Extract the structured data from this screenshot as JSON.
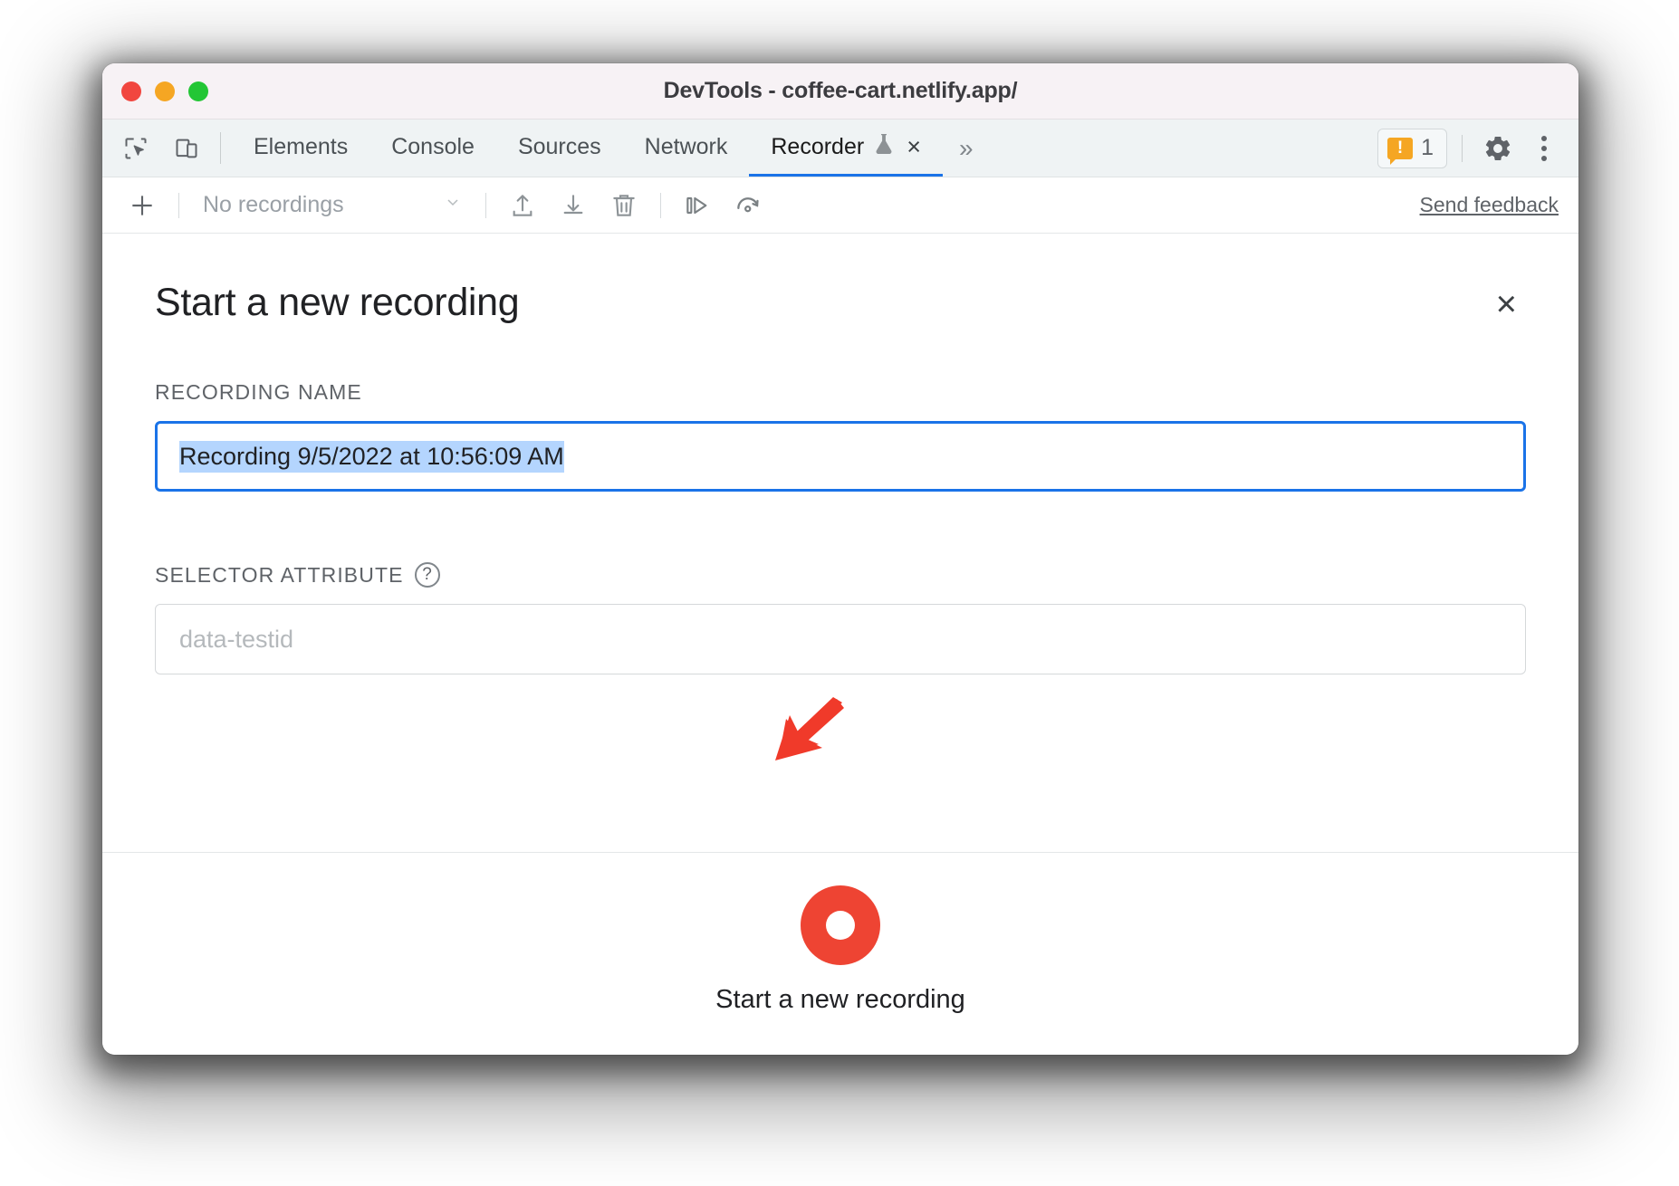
{
  "window": {
    "title": "DevTools - coffee-cart.netlify.app/",
    "traffic_lights": [
      "close",
      "minimize",
      "maximize"
    ],
    "colors": {
      "titlebar_bg": "#f7f2f5",
      "close": "#f1463f",
      "minimize": "#f5a623",
      "maximize": "#23c635",
      "accent": "#1a73e8",
      "record_red": "#ee4433",
      "selection_blue": "#b4d5fe",
      "annotation_red": "#f03a2a"
    }
  },
  "tabstrip": {
    "left_icons": [
      {
        "name": "inspect-element-icon",
        "label": "Inspect element"
      },
      {
        "name": "device-toolbar-icon",
        "label": "Toggle device toolbar"
      }
    ],
    "tabs": [
      {
        "label": "Elements",
        "active": false
      },
      {
        "label": "Console",
        "active": false
      },
      {
        "label": "Sources",
        "active": false
      },
      {
        "label": "Network",
        "active": false
      },
      {
        "label": "Recorder",
        "active": true,
        "experiment_icon": "flask-icon",
        "closable": true
      }
    ],
    "overflow_label": "»",
    "warnings": {
      "count": "1",
      "icon": "warning-icon"
    },
    "settings_label": "Settings",
    "more_label": "Customize and control DevTools"
  },
  "recorder_toolbar": {
    "add_label": "+",
    "recordings_select": {
      "value": "No recordings",
      "chevron": "chevron-down-icon"
    },
    "buttons": [
      {
        "name": "export-recording-icon",
        "label": "Export recording"
      },
      {
        "name": "import-recording-icon",
        "label": "Import recording"
      },
      {
        "name": "delete-recording-icon",
        "label": "Delete recording"
      },
      {
        "name": "step-replay-icon",
        "label": "Step replay"
      },
      {
        "name": "replay-speed-icon",
        "label": "Replay settings"
      }
    ],
    "feedback_link": "Send feedback"
  },
  "main": {
    "title": "Start a new recording",
    "close_label": "×",
    "recording_name": {
      "label": "Recording name",
      "value": "Recording 9/5/2022 at 10:56:09 AM",
      "selected": true,
      "focused": true
    },
    "selector_attribute": {
      "label": "Selector attribute",
      "help_glyph": "?",
      "placeholder": "data-testid",
      "value": ""
    },
    "footer": {
      "record_button_label": "Start a new recording",
      "record_icon": "record-circle-icon"
    }
  },
  "annotation": {
    "arrow": "pointer-arrow-down-left",
    "points_at": "recording-name-input"
  }
}
